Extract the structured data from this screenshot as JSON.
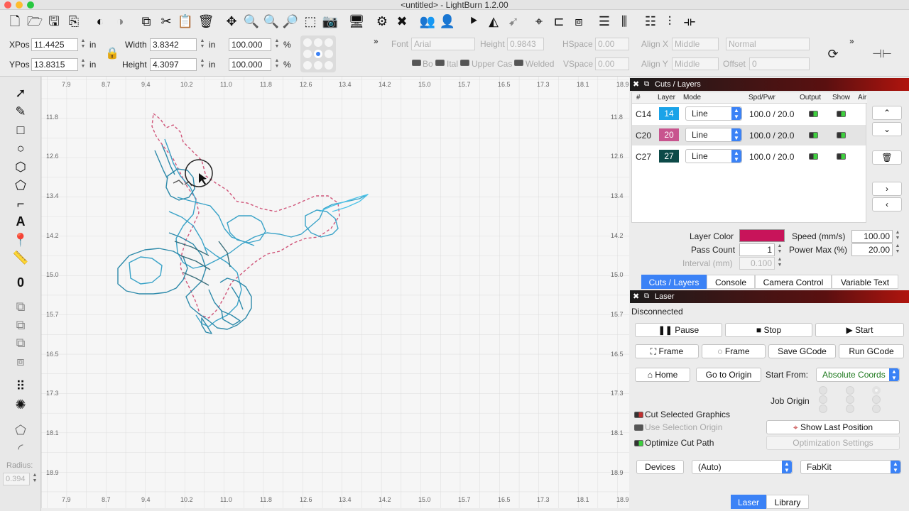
{
  "window": {
    "title": "<untitled> - LightBurn 1.2.00"
  },
  "toolbar": {
    "icons": [
      "new-file-icon",
      "open-folder-icon",
      "save-icon",
      "export-icon",
      "undo-icon",
      "redo-icon",
      "copy-icon",
      "cut-icon",
      "paste-icon",
      "delete-icon",
      "move-icon",
      "zoom-in-icon",
      "zoom-out-icon",
      "zoom-page-icon",
      "zoom-selection-icon",
      "camera-icon",
      "monitor-icon",
      "settings-icon",
      "tools-icon",
      "user-icon",
      "users-icon",
      "mirror-horizontal-icon",
      "mirror-vertical-icon",
      "send-icon",
      "target-icon",
      "align-left-icon",
      "align-center-icon",
      "distribute-icon",
      "align-top-icon",
      "align-middle-icon",
      "dock-icon"
    ]
  },
  "props": {
    "xpos_label": "XPos",
    "xpos_value": "11.4425",
    "ypos_label": "YPos",
    "ypos_value": "13.8315",
    "width_label": "Width",
    "width_value": "3.8342",
    "height_label": "Height",
    "height_value": "4.3097",
    "unit": "in",
    "scale_w": "100.000",
    "scale_h": "100.000",
    "percent": "%",
    "font_label": "Font",
    "font_value": "Arial",
    "text_height_label": "Height",
    "text_height_value": "0.9843",
    "hspace_label": "HSpace",
    "hspace_value": "0.00",
    "vspace_label": "VSpace",
    "vspace_value": "0.00",
    "alignx_label": "Align X",
    "alignx_value": "Middle",
    "aligny_label": "Align Y",
    "aligny_value": "Middle",
    "style_value": "Normal",
    "offset_label": "Offset",
    "offset_value": "0",
    "bold_label": "Bo",
    "italic_label": "Ital",
    "uppercase_label": "Upper Cas",
    "welded_label": "Welded"
  },
  "left_tools": [
    "select-icon",
    "pen-icon",
    "rectangle-icon",
    "ellipse-icon",
    "polygon-icon",
    "pentagon-icon",
    "corner-icon",
    "text-icon",
    "position-icon",
    "measure-icon",
    "offset-icon",
    "boolean-union-icon",
    "boolean-subtract-icon",
    "boolean-intersect-icon",
    "weld-icon",
    "grid-array-icon",
    "circular-array-icon",
    "rotate-icon",
    "corner-radius-icon"
  ],
  "radius": {
    "label": "Radius:",
    "value": "0.394"
  },
  "ruler": {
    "top": [
      "7.9",
      "8.7",
      "9.4",
      "10.2",
      "11.0",
      "11.8",
      "12.6",
      "13.4",
      "14.2",
      "15.0",
      "15.7",
      "16.5",
      "17.3",
      "18.1",
      "18.9"
    ],
    "left": [
      "11.8",
      "12.6",
      "13.4",
      "14.2",
      "15.0",
      "15.7",
      "16.5",
      "17.3",
      "18.1",
      "18.9"
    ]
  },
  "cuts_panel": {
    "title": "Cuts / Layers",
    "headers": [
      "#",
      "Layer",
      "Mode",
      "Spd/Pwr",
      "Output",
      "Show",
      "Air"
    ],
    "rows": [
      {
        "id": "C14",
        "layer": "14",
        "color": "#1aa3e8",
        "mode": "Line",
        "spdpwr": "100.0 / 20.0"
      },
      {
        "id": "C20",
        "layer": "20",
        "color": "#c8548e",
        "mode": "Line",
        "spdpwr": "100.0 / 20.0"
      },
      {
        "id": "C27",
        "layer": "27",
        "color": "#0d4a48",
        "mode": "Line",
        "spdpwr": "100.0 / 20.0"
      }
    ],
    "layer_color_label": "Layer Color",
    "layer_color": "#c8145a",
    "speed_label": "Speed (mm/s)",
    "speed_value": "100.00",
    "pass_count_label": "Pass Count",
    "pass_count_value": "1",
    "power_max_label": "Power Max (%)",
    "power_max_value": "20.00",
    "interval_label": "Interval (mm)",
    "interval_value": "0.100"
  },
  "tabs": [
    "Cuts / Layers",
    "Console",
    "Camera Control",
    "Variable Text"
  ],
  "laser_panel": {
    "title": "Laser",
    "status": "Disconnected",
    "pause": "Pause",
    "stop": "Stop",
    "start": "Start",
    "frame1": "Frame",
    "frame2": "Frame",
    "save_gcode": "Save GCode",
    "run_gcode": "Run GCode",
    "home": "Home",
    "go_to_origin": "Go to Origin",
    "start_from_label": "Start From:",
    "start_from_value": "Absolute Coords",
    "job_origin_label": "Job Origin",
    "cut_selected": "Cut Selected Graphics",
    "use_selection_origin": "Use Selection Origin",
    "optimize_cut_path": "Optimize Cut Path",
    "show_last_position": "Show Last Position",
    "optimization_settings": "Optimization Settings",
    "devices": "Devices",
    "device_port": "(Auto)",
    "device_name": "FabKit"
  },
  "bottom_tabs": [
    "Laser",
    "Library"
  ]
}
